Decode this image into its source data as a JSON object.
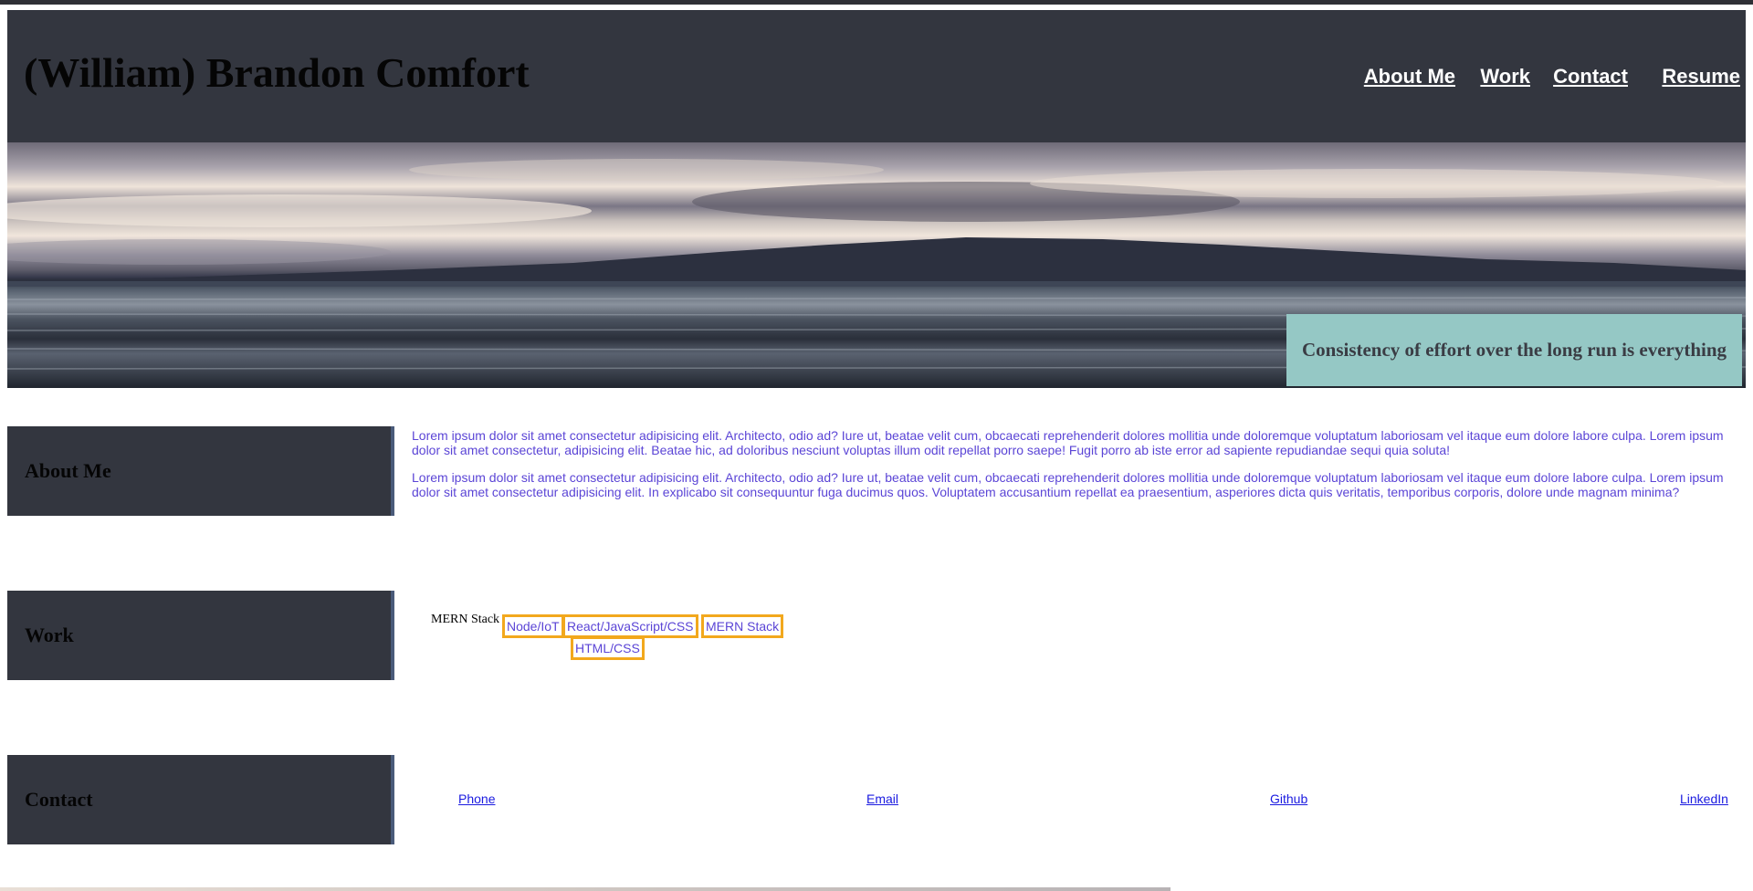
{
  "header": {
    "title": "(William) Brandon Comfort",
    "nav": [
      {
        "label": "About Me",
        "key": "about"
      },
      {
        "label": "Work",
        "key": "work"
      },
      {
        "label": "Contact",
        "key": "contact"
      },
      {
        "label": "Resume",
        "key": "resume"
      }
    ]
  },
  "hero": {
    "quote": "Consistency of effort over the long run is everything"
  },
  "about": {
    "heading": "About Me",
    "paragraphs": [
      "Lorem ipsum dolor sit amet consectetur adipisicing elit. Architecto, odio ad? Iure ut, beatae velit cum, obcaecati reprehenderit dolores mollitia unde doloremque voluptatum laboriosam vel itaque eum dolore labore culpa. Lorem ipsum dolor sit amet consectetur, adipisicing elit. Beatae hic, ad doloribus nesciunt voluptas illum odit repellat porro saepe! Fugit porro ab iste error ad sapiente repudiandae sequi quia soluta!",
      "Lorem ipsum dolor sit amet consectetur adipisicing elit. Architecto, odio ad? Iure ut, beatae velit cum, obcaecati reprehenderit dolores mollitia unde doloremque voluptatum laboriosam vel itaque eum dolore labore culpa. Lorem ipsum dolor sit amet consectetur adipisicing elit. In explicabo sit consequuntur fuga ducimus quos. Voluptatem accusantium repellat ea praesentium, asperiores dicta quis veritatis, temporibus corporis, dolore unde magnam minima?"
    ]
  },
  "work": {
    "heading": "Work",
    "caption": "MERN Stack",
    "tags": [
      "Node/IoT",
      "React/JavaScript/CSS",
      "MERN Stack",
      "HTML/CSS"
    ]
  },
  "contact": {
    "heading": "Contact",
    "links": [
      "Phone",
      "Email",
      "Github",
      "LinkedIn"
    ]
  },
  "colors": {
    "header_bg": "#33363f",
    "quote_bg": "#95c8c5",
    "body_text": "#5b45d6",
    "tag_border": "#f2a81d",
    "link": "#1a1ae0"
  }
}
